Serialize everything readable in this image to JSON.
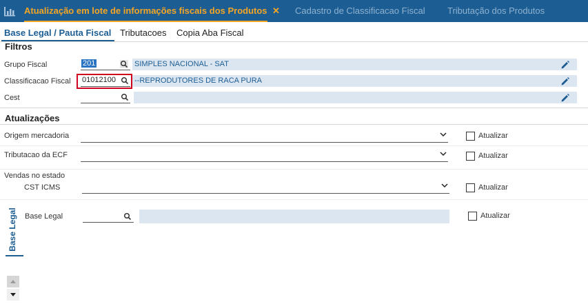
{
  "tabs": [
    {
      "label": "Atualização em lote de informações fiscais dos Produtos",
      "active": true,
      "close": "✕"
    },
    {
      "label": "Cadastro de Classificacao Fiscal",
      "active": false
    },
    {
      "label": "Tributação dos Produtos",
      "active": false
    }
  ],
  "subtabs": [
    {
      "label": "Base Legal / Pauta Fiscal",
      "active": true
    },
    {
      "label": "Tributacoes",
      "active": false
    },
    {
      "label": "Copia Aba Fiscal",
      "active": false
    }
  ],
  "filtros": {
    "title": "Filtros",
    "grupo_fiscal": {
      "label": "Grupo Fiscal",
      "value": "201",
      "description": "SIMPLES NACIONAL - SAT"
    },
    "classificacao_fiscal": {
      "label": "Classificacao Fiscal",
      "value": "01012100",
      "description": "--REPRODUTORES DE RACA PURA"
    },
    "cest": {
      "label": "Cest",
      "value": "",
      "description": ""
    }
  },
  "atualizacoes": {
    "title": "Atualizações",
    "origem_mercadoria": {
      "label": "Origem mercadoria",
      "value": "",
      "checkbox_label": "Atualizar",
      "checked": false
    },
    "tributacao_ecf": {
      "label": "Tributacao da ECF",
      "value": "",
      "checkbox_label": "Atualizar",
      "checked": false
    },
    "vendas_no_estado": {
      "label": "Vendas no estado"
    },
    "cst_icms": {
      "label": "CST ICMS",
      "value": "",
      "checkbox_label": "Atualizar",
      "checked": false
    }
  },
  "base_legal": {
    "vertical_tab_label": "Base Legal",
    "label": "Base Legal",
    "value": "",
    "description": "",
    "checkbox_label": "Atualizar",
    "checked": false
  },
  "icons": {
    "app": "bar-chart-icon",
    "search": "search-icon",
    "edit": "pencil-icon",
    "dropdown": "chevron-down-icon",
    "scroll_up": "arrow-up-icon",
    "scroll_down": "arrow-down-icon"
  },
  "colors": {
    "topbar": "#1c5d94",
    "active_tab": "#f5a623",
    "inactive_tab": "#8fb2cf",
    "accent": "#1c5d94",
    "description_bg": "#dce6f1",
    "highlight_box": "#d0021b",
    "selection": "#2a73c2"
  }
}
